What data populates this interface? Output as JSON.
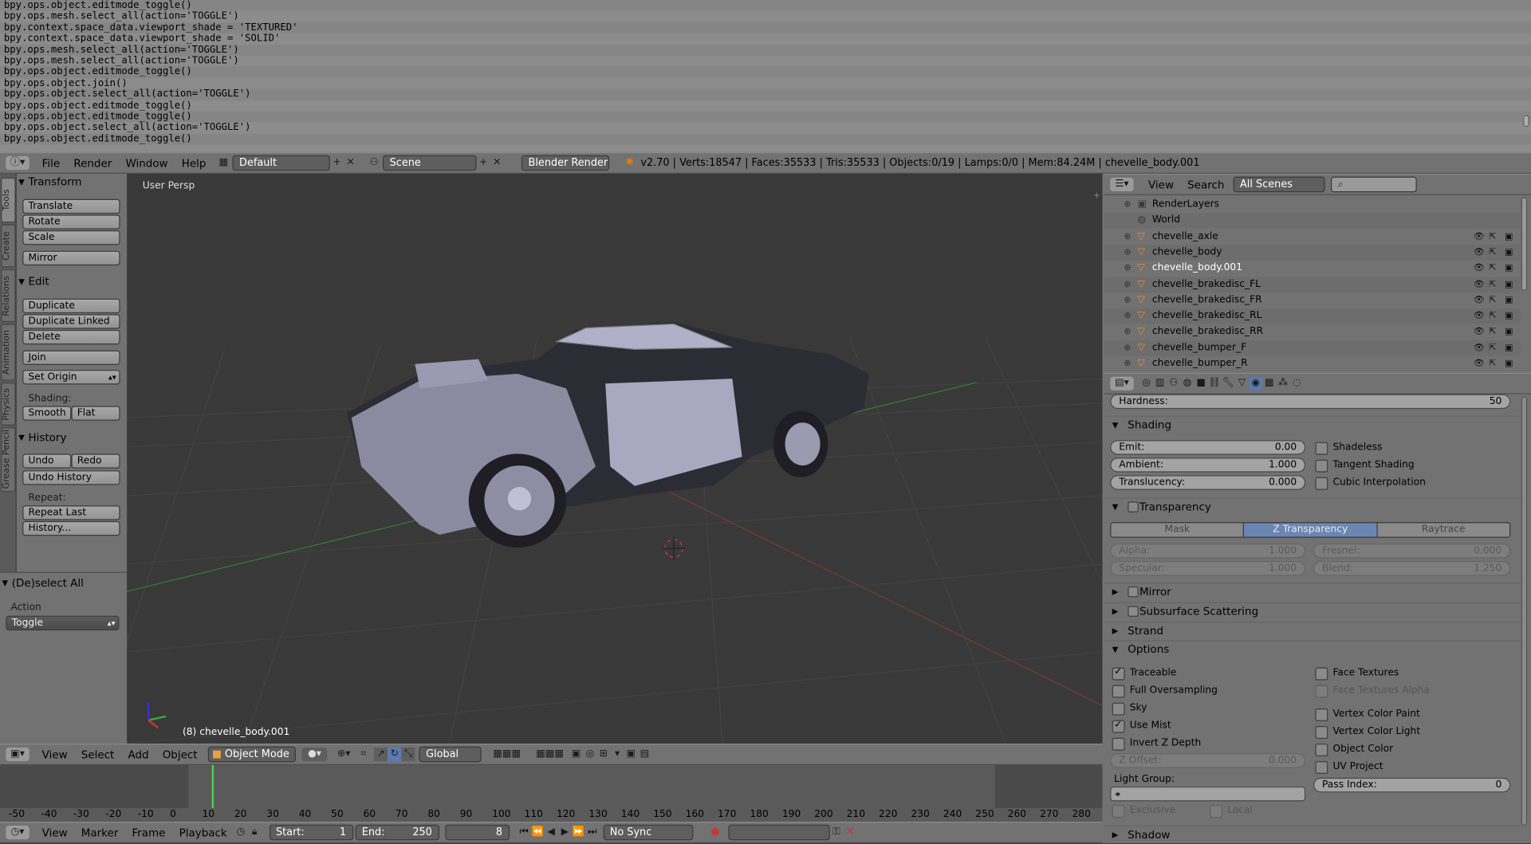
{
  "console": {
    "lines": [
      "bpy.ops.object.editmode_toggle()",
      "bpy.ops.mesh.select_all(action='TOGGLE')",
      "bpy.context.space_data.viewport_shade = 'TEXTURED'",
      "bpy.context.space_data.viewport_shade = 'SOLID'",
      "bpy.ops.mesh.select_all(action='TOGGLE')",
      "bpy.ops.mesh.select_all(action='TOGGLE')",
      "bpy.ops.object.editmode_toggle()",
      "bpy.ops.object.join()",
      "bpy.ops.object.select_all(action='TOGGLE')",
      "bpy.ops.object.editmode_toggle()",
      "bpy.ops.object.editmode_toggle()",
      "bpy.ops.object.select_all(action='TOGGLE')",
      "bpy.ops.object.editmode_toggle()"
    ]
  },
  "topbar": {
    "menus": [
      "File",
      "Render",
      "Window",
      "Help"
    ],
    "layout": "Default",
    "scene": "Scene",
    "engine": "Blender Render",
    "stats": "v2.70 | Verts:18547 | Faces:35533 | Tris:35533 | Objects:0/19 | Lamps:0/0 | Mem:84.24M | chevelle_body.001"
  },
  "tabs": [
    "Tools",
    "Create",
    "Relations",
    "Animation",
    "Physics",
    "Grease Pencil"
  ],
  "shelf": {
    "transform": "Transform",
    "translate": "Translate",
    "rotate": "Rotate",
    "scale": "Scale",
    "mirror": "Mirror",
    "edit": "Edit",
    "duplicate": "Duplicate",
    "duplicate_linked": "Duplicate Linked",
    "delete": "Delete",
    "join": "Join",
    "set_origin": "Set Origin",
    "shading": "Shading:",
    "smooth": "Smooth",
    "flat": "Flat",
    "history": "History",
    "undo": "Undo",
    "redo": "Redo",
    "undo_history": "Undo History",
    "repeat": "Repeat:",
    "repeat_last": "Repeat Last",
    "history_dots": "History..."
  },
  "operator": {
    "title": "(De)select All",
    "action_label": "Action",
    "action_value": "Toggle"
  },
  "viewport": {
    "label": "User Persp",
    "object_label": "(8) chevelle_body.001"
  },
  "view3d_header": {
    "menus": [
      "View",
      "Select",
      "Add",
      "Object"
    ],
    "mode": "Object Mode",
    "orientation": "Global"
  },
  "timeline": {
    "ticks": [
      "-50",
      "-40",
      "-30",
      "-20",
      "-10",
      "0",
      "10",
      "20",
      "30",
      "40",
      "50",
      "60",
      "70",
      "80",
      "90",
      "100",
      "110",
      "120",
      "130",
      "140",
      "150",
      "160",
      "170",
      "180",
      "190",
      "200",
      "210",
      "220",
      "230",
      "240",
      "250",
      "260",
      "270",
      "280"
    ],
    "menus": [
      "View",
      "Marker",
      "Frame",
      "Playback"
    ],
    "start_label": "Start:",
    "start": "1",
    "end_label": "End:",
    "end": "250",
    "current": "8",
    "sync": "No Sync"
  },
  "outliner": {
    "menus": [
      "View",
      "Search"
    ],
    "filter": "All Scenes",
    "rows": [
      "RenderLayers",
      "World",
      "chevelle_axle",
      "chevelle_body",
      "chevelle_body.001",
      "chevelle_brakedisc_FL",
      "chevelle_brakedisc_FR",
      "chevelle_brakedisc_RL",
      "chevelle_brakedisc_RR",
      "chevelle_bumper_F",
      "chevelle_bumper_R"
    ]
  },
  "props": {
    "hardness_label": "Hardness:",
    "hardness": "50",
    "shading": "Shading",
    "emit_label": "Emit:",
    "emit": "0.00",
    "ambient_label": "Ambient:",
    "ambient": "1.000",
    "translucency_label": "Translucency:",
    "translucency": "0.000",
    "shadeless": "Shadeless",
    "tangent": "Tangent Shading",
    "cubic": "Cubic Interpolation",
    "transparency": "Transparency",
    "mask": "Mask",
    "ztrans": "Z Transparency",
    "raytrace": "Raytrace",
    "alpha_label": "Alpha:",
    "alpha": "1.000",
    "fresnel_label": "Fresnel:",
    "fresnel": "0.000",
    "specular_label": "Specular:",
    "specular": "1.000",
    "blend_label": "Blend:",
    "blend": "1.250",
    "mirror": "Mirror",
    "sss": "Subsurface Scattering",
    "strand": "Strand",
    "options": "Options",
    "traceable": "Traceable",
    "full_over": "Full Oversampling",
    "sky": "Sky",
    "use_mist": "Use Mist",
    "invert_z": "Invert Z Depth",
    "face_tex": "Face Textures",
    "face_tex_alpha": "Face Textures Alpha",
    "vcol_paint": "Vertex Color Paint",
    "vcol_light": "Vertex Color Light",
    "obj_color": "Object Color",
    "uv_project": "UV Project",
    "zoffset_label": "Z Offset:",
    "zoffset": "0.000",
    "light_group": "Light Group:",
    "pass_index_label": "Pass Index:",
    "pass_index": "0",
    "exclusive": "Exclusive",
    "local": "Local",
    "shadow": "Shadow"
  }
}
